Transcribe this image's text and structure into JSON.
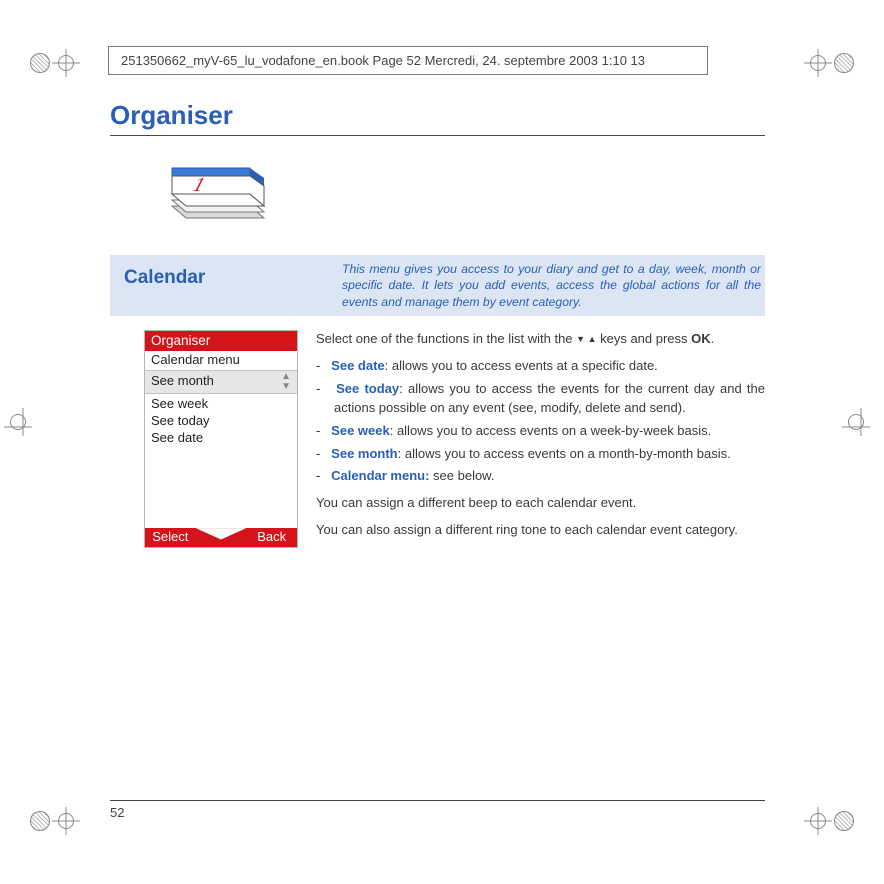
{
  "header": {
    "crop_text": "251350662_myV-65_lu_vodafone_en.book  Page 52  Mercredi, 24. septembre 2003  1:10 13"
  },
  "page": {
    "title": "Organiser",
    "number": "52"
  },
  "section": {
    "label": "Calendar",
    "description": "This menu gives you access to your diary and get to a day, week, month or specific date. It lets you add events, access the global actions for all the events and manage them by event category."
  },
  "phone": {
    "title": "Organiser",
    "subtitle": "Calendar menu",
    "selected": "See month",
    "items": [
      "See week",
      "See today",
      "See date"
    ],
    "soft_left": "Select",
    "soft_right": "Back"
  },
  "body": {
    "intro_pre": "Select one of the functions in the list with the ",
    "intro_post": " keys and press ",
    "intro_ok": "OK",
    "intro_end": ".",
    "items": [
      {
        "term": "See date",
        "text": ": allows you to access events at a specific date."
      },
      {
        "term": "See today",
        "text": ": allows you to access the events for the current day and the actions possible on any event (see, modify, delete and send)."
      },
      {
        "term": "See week",
        "text": ": allows you to access events on a week-by-week basis."
      },
      {
        "term": "See month",
        "text": ": allows you to access events on a month-by-month basis."
      },
      {
        "term": "Calendar menu:",
        "text": " see below."
      }
    ],
    "p1": "You can assign a different beep to each calendar event.",
    "p2": "You can also assign a different ring tone to each calendar event category."
  }
}
